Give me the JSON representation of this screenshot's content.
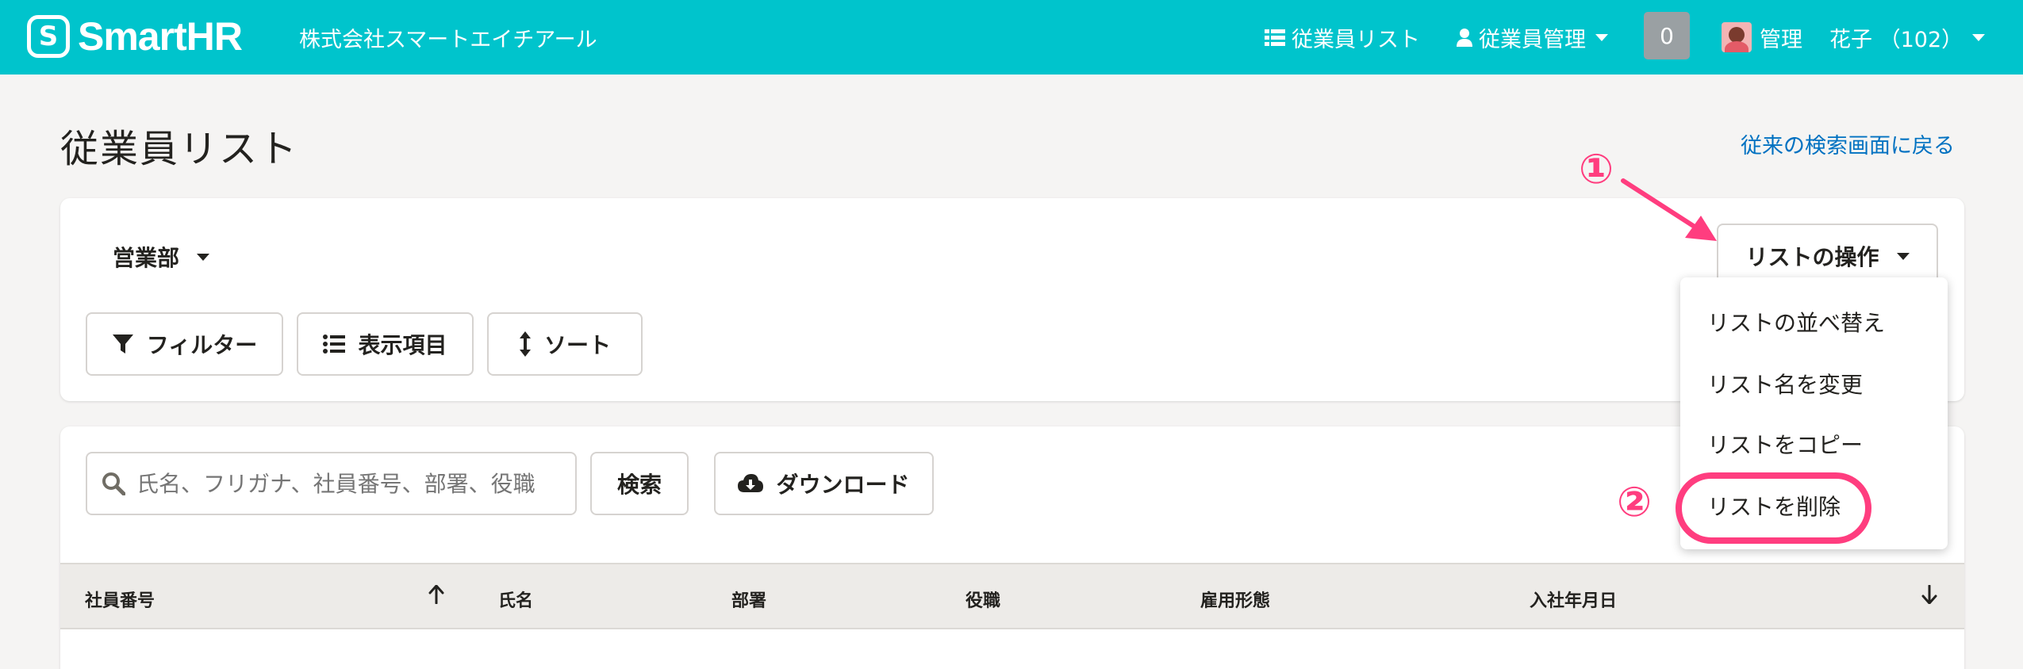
{
  "header": {
    "logo_mark": "S",
    "logo_text": "SmartHR",
    "company": "株式会社スマートエイチアール",
    "nav_list": "従業員リスト",
    "nav_manage": "従業員管理",
    "notification_count": "0",
    "user_role": "管理",
    "user_name": "花子 （102）"
  },
  "page": {
    "title": "従業員リスト",
    "back_link": "従来の検索画面に戻る"
  },
  "list": {
    "selected": "営業部"
  },
  "toolbar": {
    "filter": "フィルター",
    "columns": "表示項目",
    "sort": "ソート",
    "list_ops": "リストの操作"
  },
  "menu": {
    "items": [
      "リストの並べ替え",
      "リスト名を変更",
      "リストをコピー",
      "リストを削除"
    ]
  },
  "search": {
    "placeholder": "氏名、フリガナ、社員番号、部署、役職",
    "button": "検索",
    "download": "ダウンロード"
  },
  "table": {
    "columns": [
      "社員番号",
      "氏名",
      "部署",
      "役職",
      "雇用形態",
      "入社年月日"
    ]
  },
  "annotations": {
    "step1": "①",
    "step2": "②",
    "color": "#ff3d7f"
  },
  "colors": {
    "brand": "#00c4cc",
    "link": "#0071c1"
  }
}
